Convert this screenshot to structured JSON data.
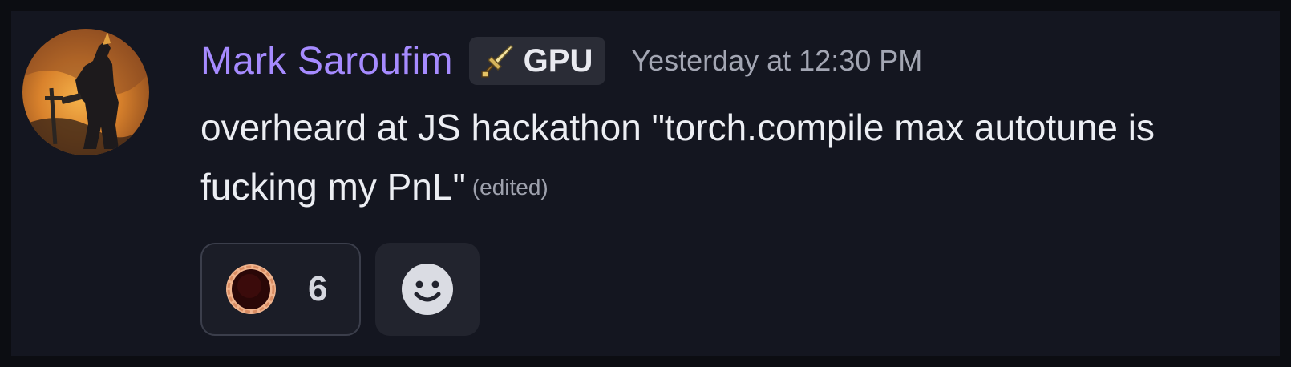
{
  "message": {
    "author": "Mark Saroufim",
    "role_badge": "GPU",
    "timestamp": "Yesterday at 12:30 PM",
    "text": "overheard at JS hackathon \"torch.compile max autotune is fucking my PnL\"",
    "edited_label": "(edited)"
  },
  "reactions": [
    {
      "emoji": "dark-circle-emoji",
      "count": "6"
    }
  ],
  "icons": {
    "avatar": "knight-avatar",
    "badge": "sword-icon",
    "add_reaction": "smiley-face-icon"
  },
  "colors": {
    "username": "#a68bff",
    "background": "#141620",
    "timestamp": "#a3a6b3"
  }
}
